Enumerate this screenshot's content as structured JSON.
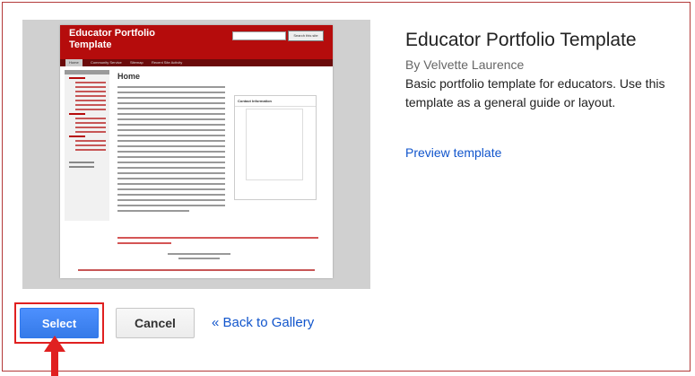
{
  "template": {
    "title": "Educator Portfolio Template",
    "author": "By Velvette Laurence",
    "description": "Basic portfolio template for educators. Use this template as a general guide or layout.",
    "preview_link": "Preview template"
  },
  "thumbnail": {
    "site_title": "Educator Portfolio Template",
    "search_button": "Search this site",
    "nav": [
      "Home",
      "Community Service",
      "Sitemap",
      "Recent Site Activity"
    ],
    "page_title": "Home",
    "contact_title": "Contact Information"
  },
  "actions": {
    "select_label": "Select",
    "cancel_label": "Cancel",
    "back_label": "« Back to Gallery"
  },
  "colors": {
    "frame_border": "#b33a3a",
    "select_button": "#4d90fe",
    "highlight": "#e02020",
    "link": "#1155cc",
    "thumbnail_header": "#b50c0c"
  },
  "icons": {
    "annotation_arrow": "up-arrow-icon"
  }
}
